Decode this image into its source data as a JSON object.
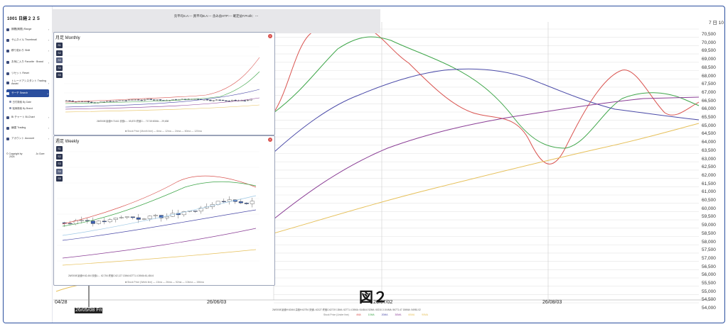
{
  "app": {
    "title": "1001 日経２２５"
  },
  "sidebar": {
    "items": [
      {
        "label": "期間(期限) Range"
      },
      {
        "label": "サムネイル Thumbnail"
      },
      {
        "label": "移り変わり Shift"
      },
      {
        "label": "お気に入り Favorite · Brand"
      },
      {
        "label": "リセット Reset"
      },
      {
        "label": "トレードアシスタント Trading Assist"
      },
      {
        "label": "サーチ Search"
      },
      {
        "label": "Bi チャート Bi-Chart"
      },
      {
        "label": "練習 Trading"
      },
      {
        "label": "アカウント Account"
      }
    ],
    "subitems": [
      {
        "label": "日付検索 By Date"
      },
      {
        "label": "銘柄検索 By Brand"
      }
    ],
    "copyright": "© Copyright by",
    "copyright2": "Jo Gore",
    "copyright_year": "2024"
  },
  "topbar": {
    "text": "売平均S.A:--- 買平均B.A:--- 含み益HTP:--- 確定益F.Profit：---"
  },
  "monthly": {
    "title": "月足 Monthly",
    "buttons": [
      "S1",
      "S2",
      "S3",
      "S4",
      "S5"
    ],
    "readout": "26/05/08 始値H:71441 安値L:... 65,870  終値C:... 71715  60MA:... 29,638",
    "legend": "■ Stock Price (Month line)   — 6ma  — 12ma  — 24ma  — 60ma  — 120ma"
  },
  "weekly": {
    "title": "週足 Weekly",
    "buttons": [
      "S1",
      "S2",
      "S3",
      "S4",
      "S5"
    ],
    "readout": "26/05/08 始値H:62,464  安値L:... 62,754  終値C:62,127  13MA:62771.4  26MA:61,484.6",
    "legend": "■ Stock Price (Week line)   — 13ma  — 26ma  — 52ma  — 104ma  — 156ma"
  },
  "main": {
    "figure_label": "図２",
    "y_top_label": "7 日 10",
    "y_ticks": [
      "70,500",
      "70,000",
      "69,500",
      "69,000",
      "68,500",
      "68,000",
      "67,500",
      "67,000",
      "66,500",
      "66,000",
      "65,500",
      "65,000",
      "64,500",
      "64,000",
      "63,500",
      "63,000",
      "62,500",
      "62,000",
      "61,500",
      "61,000",
      "60,500",
      "60,000",
      "59,500",
      "59,000",
      "58,500",
      "58,000",
      "57,500",
      "57,000",
      "56,500",
      "56,000",
      "55,500",
      "55,000",
      "54,500",
      "54,000"
    ],
    "x_labels": [
      "04/28",
      "26/06/03",
      "26/07/02",
      "26/08/03"
    ],
    "selected_date": "26/05/08 Fri",
    "readout": "26/05/08 始値H:62464  高値H:62754  安値L:62127  終値C:62719  13MA: 62771.4  26MA: 61484.6  52MA: 60210.3  104MA: 56771.47  156MA: 54981.02",
    "legend": [
      "Stock Price (Under line)",
      "4MA",
      "10MA",
      "20MA",
      "30MA",
      "60MA",
      "90MA"
    ],
    "colors": {
      "red": "#d9534f",
      "green": "#3fa64a",
      "blue": "#4a4aa8",
      "purple": "#8a3d95",
      "yellow": "#e6c05a"
    }
  }
}
